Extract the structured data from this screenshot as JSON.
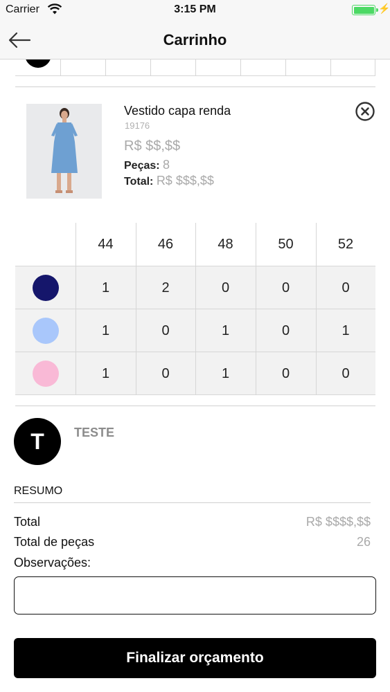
{
  "status_bar": {
    "carrier": "Carrier",
    "time": "3:15 PM",
    "wifi_icon": "wifi-icon",
    "battery_icon": "battery-full-icon",
    "battery_color": "#4cd964"
  },
  "nav": {
    "title": "Carrinho",
    "back_icon": "arrow-left-icon"
  },
  "product": {
    "name": "Vestido capa renda",
    "ref": "19176",
    "price": "R$ $$,$$",
    "pieces_label": "Peças:",
    "pieces_value": "8",
    "total_label": "Total:",
    "total_value": "R$ $$$,$$",
    "remove_icon": "close-circle-icon"
  },
  "size_grid": {
    "sizes": [
      "44",
      "46",
      "48",
      "50",
      "52"
    ],
    "rows": [
      {
        "color": "#15166b",
        "quantities": [
          "1",
          "2",
          "0",
          "0",
          "0"
        ]
      },
      {
        "color": "#a9c7fb",
        "quantities": [
          "1",
          "0",
          "1",
          "0",
          "1"
        ]
      },
      {
        "color": "#f9b9d6",
        "quantities": [
          "1",
          "0",
          "1",
          "0",
          "0"
        ]
      }
    ]
  },
  "seller": {
    "initial": "T",
    "name": "TESTE"
  },
  "summary": {
    "title": "RESUMO",
    "total_label": "Total",
    "total_value": "R$ $$$$,$$",
    "pieces_label": "Total de peças",
    "pieces_value": "26",
    "notes_label": "Observações:",
    "notes_value": ""
  },
  "actions": {
    "finish_label": "Finalizar orçamento"
  }
}
